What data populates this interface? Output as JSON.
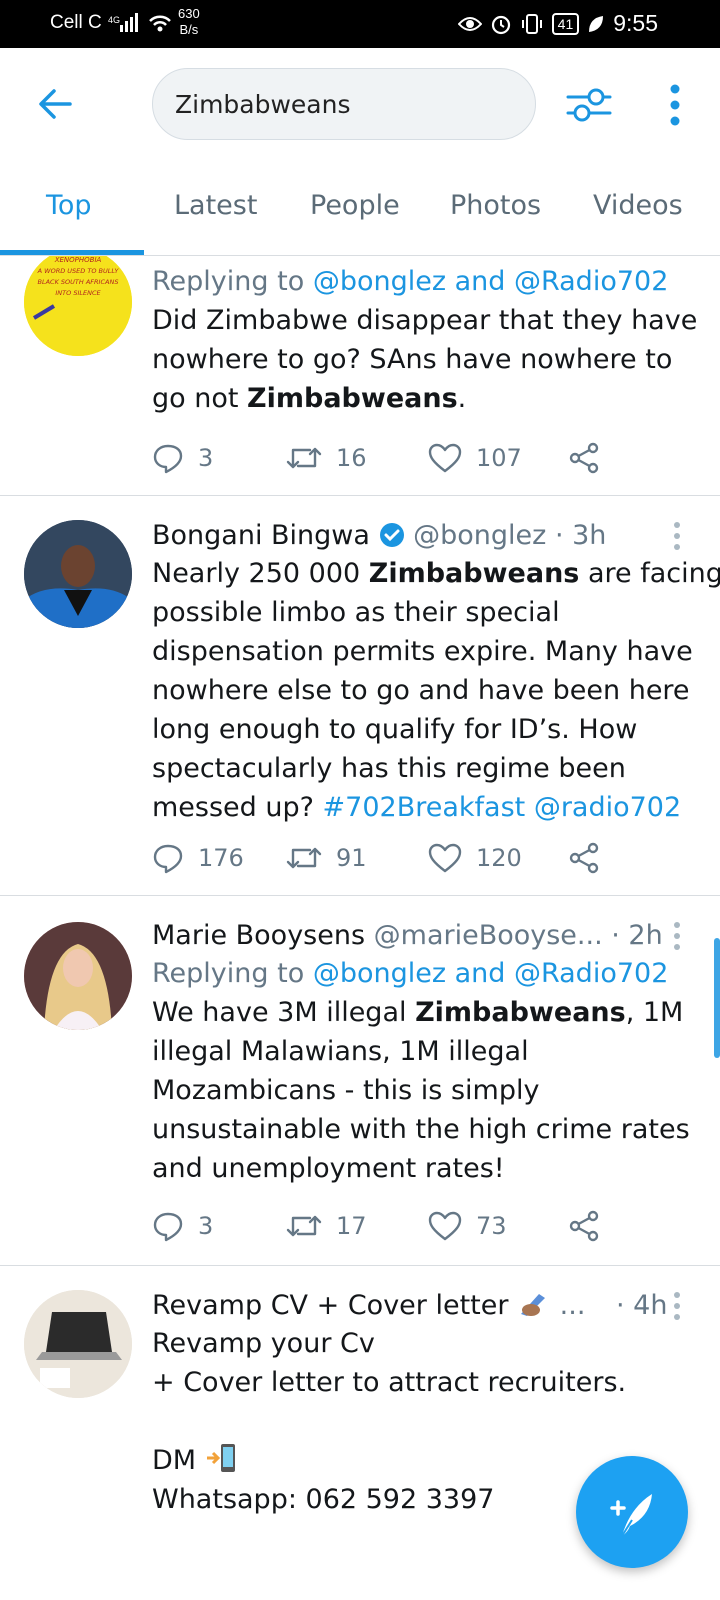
{
  "status_bar": {
    "carrier": "Cell C",
    "speed_value": "630",
    "speed_unit": "B/s",
    "battery": "41",
    "time": "9:55"
  },
  "search": {
    "query": "Zimbabweans"
  },
  "tabs": [
    {
      "label": "Top",
      "active": true
    },
    {
      "label": "Latest",
      "active": false
    },
    {
      "label": "People",
      "active": false
    },
    {
      "label": "Photos",
      "active": false
    },
    {
      "label": "Videos",
      "active": false
    }
  ],
  "avatar_text": "XENOPHOBIA A WORD USED TO BULLY BLACK SOUTH AFRICANS INTO SILENCE",
  "tweets": [
    {
      "reply_prefix": "Replying to",
      "reply_users": "@bonglez and @Radio702",
      "body": {
        "l1": "Did Zimbabwe disappear that they have",
        "l2": "nowhere to go? SAns have nowhere to",
        "l3_pre": "go not ",
        "l3_bold": "Zimbabweans",
        "l3_post": "."
      },
      "replies": "3",
      "retweets": "16",
      "likes": "107"
    },
    {
      "name": "Bongani Bingwa",
      "handle": "@bonglez",
      "time": "· 3h",
      "body": {
        "l1_pre": "Nearly 250 000 ",
        "l1_bold": "Zimbabweans",
        "l1_post": " are facing",
        "l2": "possible limbo as their special",
        "l3": "dispensation permits expire. Many have",
        "l4": "nowhere else to go and have been here",
        "l5": "long enough to qualify for ID’s. How",
        "l6": "spectacularly has this regime been",
        "l7_pre": "messed up? ",
        "l7_tag": "#702Breakfast",
        "l7_mention": "@radio702"
      },
      "replies": "176",
      "retweets": "91",
      "likes": "120"
    },
    {
      "name": "Marie Booysens",
      "handle": "@marieBooyse...",
      "time": "· 2h",
      "reply_prefix": "Replying to",
      "reply_users": "@bonglez and @Radio702",
      "body": {
        "l1_pre": "We have 3M illegal ",
        "l1_bold": "Zimbabweans",
        "l1_post": ", 1M",
        "l2": "illegal Malawians, 1M illegal",
        "l3": "Mozambicans - this is simply",
        "l4": "unsustainable with the high crime rates",
        "l5": "and unemployment rates!"
      },
      "replies": "3",
      "retweets": "17",
      "likes": "73"
    },
    {
      "name": "Revamp CV + Cover letter",
      "name_suffix": "...",
      "time": "· 4h",
      "body": {
        "l1": "Revamp your Cv",
        "l2": "+ Cover letter to attract recruiters.",
        "l3": "DM",
        "l4": "Whatsapp: 062 592 3397"
      }
    }
  ],
  "colors": {
    "accent": "#1b95e0",
    "fab": "#1da1f2",
    "muted": "#657786"
  }
}
